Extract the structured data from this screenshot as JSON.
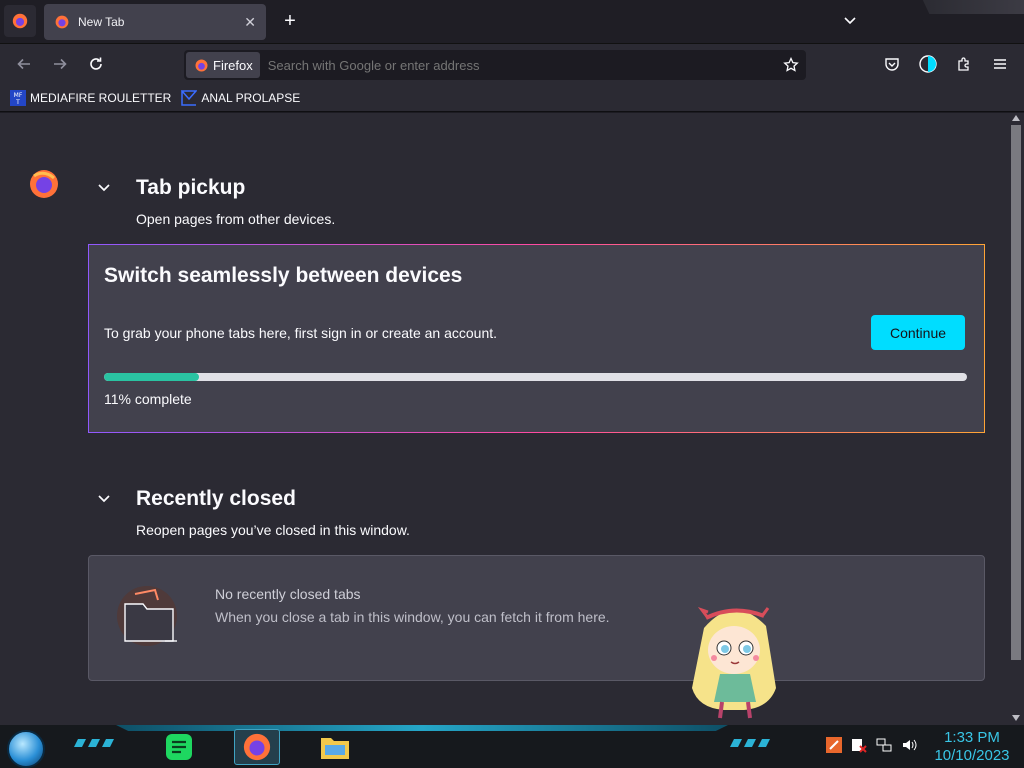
{
  "browser": {
    "tab": {
      "title": "New Tab"
    },
    "urlbar": {
      "identity_label": "Firefox",
      "placeholder": "Search with Google or enter address"
    },
    "bookmarks": [
      {
        "label": "MEDIAFIRE ROULETTER",
        "icon": "mediafire-icon"
      },
      {
        "label": "ANAL PROLAPSE",
        "icon": "bookmark-site-icon"
      }
    ]
  },
  "tab_pickup": {
    "title": "Tab pickup",
    "subtitle": "Open pages from other devices.",
    "card": {
      "title": "Switch seamlessly between devices",
      "description": "To grab your phone tabs here, first sign in or create an account.",
      "button_label": "Continue",
      "progress_fraction": 0.11,
      "progress_label": "11% complete"
    }
  },
  "recently_closed": {
    "title": "Recently closed",
    "subtitle": "Reopen pages you’ve closed in this window.",
    "empty_title": "No recently closed tabs",
    "empty_desc": "When you close a tab in this window, you can fetch it from here."
  },
  "taskbar": {
    "time": "1:33 PM",
    "date": "10/10/2023"
  },
  "colors": {
    "accent": "#00ddff",
    "progress": "#2ac3a2",
    "clock": "#39c6e6"
  }
}
